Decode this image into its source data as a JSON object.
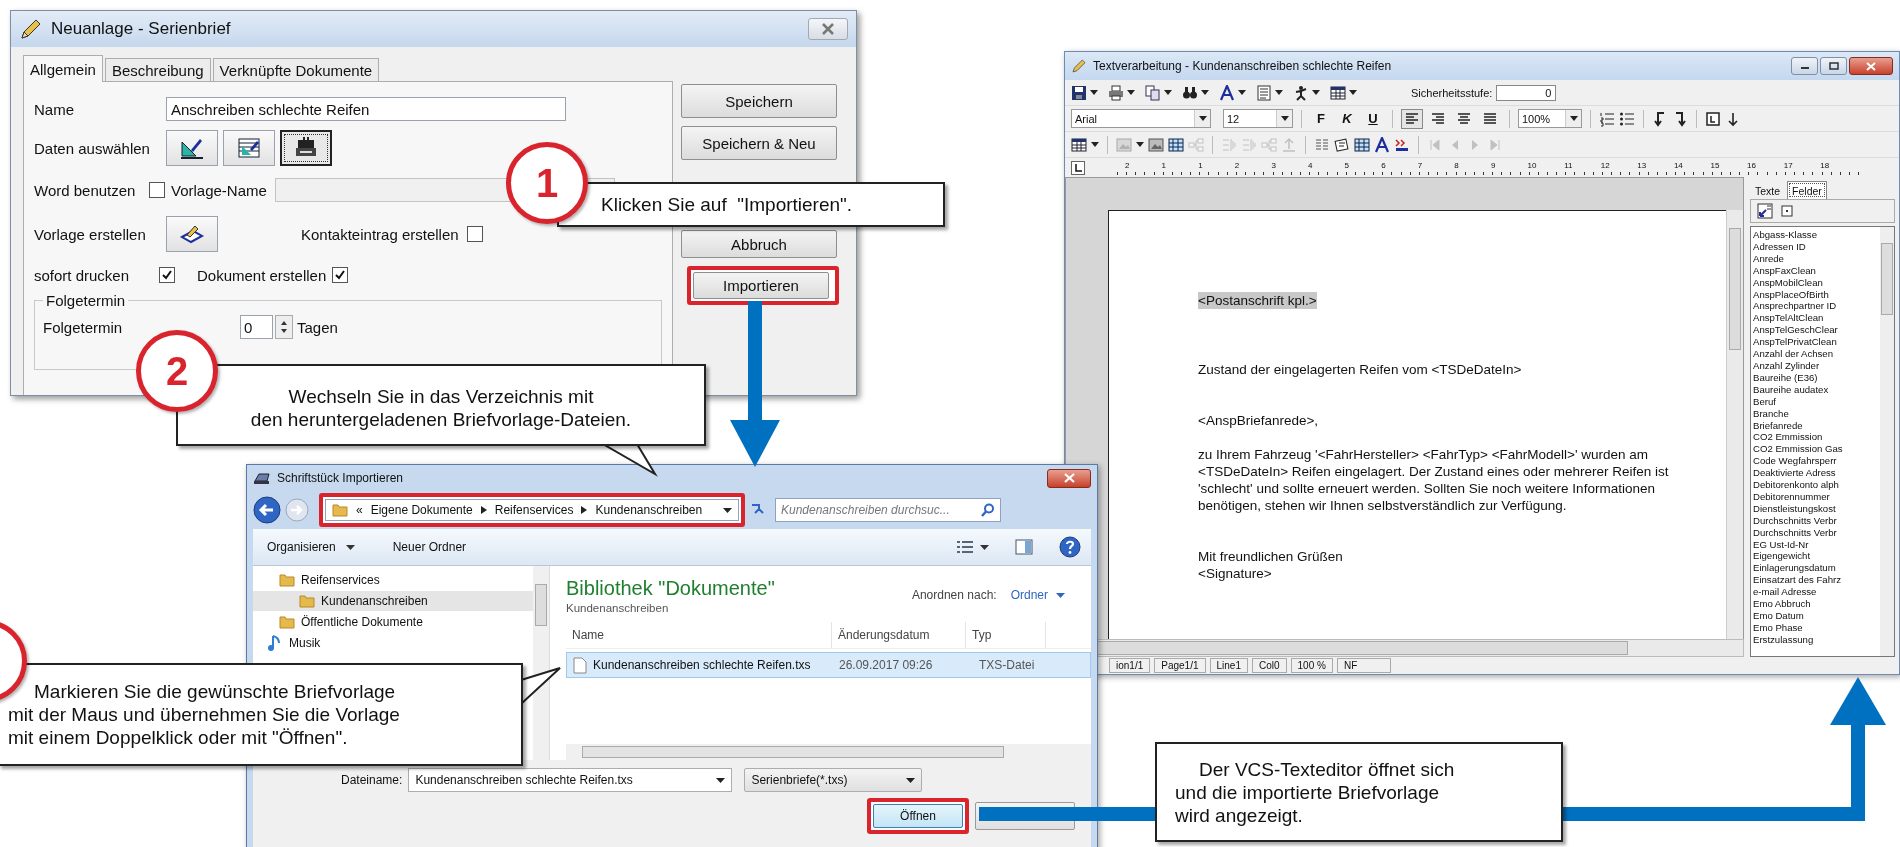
{
  "setup_dialog": {
    "title": "Neuanlage - Serienbrief",
    "tabs": [
      {
        "label": "Allgemein",
        "selected": true
      },
      {
        "label": "Beschreibung",
        "selected": false
      },
      {
        "label": "Verknüpfte Dokumente",
        "selected": false
      }
    ],
    "name": {
      "label": "Name",
      "value": "Anschreiben schlechte Reifen"
    },
    "data_select": {
      "label": "Daten auswählen",
      "options": [
        {
          "selected": false
        },
        {
          "selected": false
        },
        {
          "selected": true
        }
      ]
    },
    "use_word": {
      "label": "Word benutzen",
      "checked": false
    },
    "template_name": {
      "label": "Vorlage-Name",
      "disabled": true
    },
    "create_template": {
      "label": "Vorlage erstellen"
    },
    "contact_entry": {
      "label": "Kontakteintrag erstellen",
      "checked": false
    },
    "print_now": {
      "label": "sofort drucken",
      "checked": true
    },
    "create_document": {
      "label": "Dokument erstellen",
      "checked": true
    },
    "followup": {
      "group": "Folgetermin",
      "label": "Folgetermin",
      "value": "0",
      "unit": "Tagen"
    },
    "buttons": [
      {
        "label": "Speichern",
        "highlighted": false
      },
      {
        "label": "Speichern & Neu",
        "highlighted": false
      },
      {
        "label": "Abbruch",
        "highlighted": false
      },
      {
        "label": "Importieren",
        "highlighted": true
      }
    ]
  },
  "editor": {
    "title": "Textverarbeitung - Kundenanschreiben schlechte Reifen",
    "security_label": "Sicherheitsstufe:",
    "security_value": "0",
    "font": "Arial",
    "size": "12",
    "format_buttons": [
      "F",
      "K",
      "U"
    ],
    "alignment": [
      {
        "selected": true
      },
      {
        "selected": false
      },
      {
        "selected": false
      },
      {
        "selected": false
      }
    ],
    "zoom": "100%",
    "ruler_labels": [
      "2",
      "1",
      "1",
      "2",
      "3",
      "4",
      "5",
      "6",
      "7",
      "8",
      "9",
      "10",
      "11",
      "12",
      "13",
      "14",
      "15",
      "16",
      "17",
      "18"
    ],
    "paragraphs": [
      {
        "kind": "address",
        "text": "<Postanschrift kpl.>",
        "selected": true
      },
      {
        "kind": "subject",
        "text": "Zustand der eingelagerten Reifen vom <TSDeDateIn>",
        "selected": false
      },
      {
        "kind": "salutation",
        "text": "<AnspBriefanrede>,",
        "selected": false
      },
      {
        "kind": "body",
        "text": "zu Ihrem Fahrzeug '<FahrHersteller> <FahrTyp> <FahrModell>' wurden am <TSDeDateIn> Reifen eingelagert. Der Zustand eines oder mehrerer Reifen ist 'schlecht' und sollte erneuert werden. Sollten Sie noch weitere Informationen benötigen, stehen wir Ihnen selbstverständlich zur Verfügung.",
        "selected": false
      },
      {
        "kind": "closing",
        "text": "Mit freundlichen Grüßen",
        "selected": false
      },
      {
        "kind": "signature",
        "text": "<Signature>",
        "selected": false
      }
    ],
    "panel_tabs": [
      {
        "label": "Texte",
        "selected": false
      },
      {
        "label": "Felder",
        "selected": true
      }
    ],
    "fields": [
      "Abgass-Klasse",
      "Adressen ID",
      "Anrede",
      "AnspFaxClean",
      "AnspMobilClean",
      "AnspPlaceOfBirth",
      "Ansprechpartner ID",
      "AnspTelAltClean",
      "AnspTelGeschClear",
      "AnspTelPrivatClean",
      "Anzahl der Achsen",
      "Anzahl Zylinder",
      "Baureihe (E36)",
      "Baureihe audatex",
      "Beruf",
      "Branche",
      "Briefanrede",
      "CO2 Emmission",
      "CO2 Emmission Gas",
      "Code Wegfahrsperr",
      "Deaktivierte Adress",
      "Debitorenkonto alph",
      "Debitorennummer",
      "Dienstleistungskost",
      "Durchschnitts Verbr",
      "Durchschnitts Verbr",
      "EG Ust-Id-Nr",
      "Eigengewicht",
      "Einlagerungsdatum",
      "Einsatzart des Fahrz",
      "e-mail Adresse",
      "Emo Abbruch",
      "Emo Datum",
      "Emo Phase",
      "Erstzulassung"
    ],
    "status_bar": [
      "ion1/1",
      "Page1/1",
      "Line1",
      "Col0",
      "100 %",
      "NF"
    ]
  },
  "import_dialog": {
    "title": "Schriftstück Importieren",
    "path_prefix": "«",
    "path": [
      "Eigene Dokumente",
      "Reifenservices",
      "Kundenanschreiben"
    ],
    "search_placeholder": "Kundenanschreiben durchsuc...",
    "toolbar": [
      "Organisieren",
      "Neuer Ordner"
    ],
    "nav": [
      {
        "label": "Reifenservices",
        "kind": "folder",
        "selected": false,
        "children": [
          {
            "label": "Kundenanschreiben",
            "kind": "folder",
            "selected": true
          }
        ]
      },
      {
        "label": "Öffentliche Dokumente",
        "kind": "folder",
        "selected": false
      },
      {
        "label": "Musik",
        "kind": "music",
        "selected": false
      }
    ],
    "library_title": "Bibliothek \"Dokumente\"",
    "library_subtitle": "Kundenanschreiben",
    "arrange_label": "Anordnen nach:",
    "arrange_value": "Ordner",
    "columns": [
      "Name",
      "Änderungsdatum",
      "Typ"
    ],
    "files": [
      {
        "name": "Kundenanschreiben schlechte Reifen.txs",
        "date": "26.09.2017 09:26",
        "type": "TXS-Datei",
        "selected": true
      }
    ],
    "filename_label": "Dateiname:",
    "filename": "Kundenanschreiben schlechte Reifen.txs",
    "filter": "Serienbriefe(*.txs)",
    "open_button": "Öffnen"
  },
  "callouts": [
    {
      "marker": true,
      "number": "1",
      "lines": [
        "Klicken Sie auf  \"Importieren\"."
      ]
    },
    {
      "marker": true,
      "number": "2",
      "lines": [
        "Wechseln Sie in das Verzeichnis mit",
        "den heruntergeladenen Briefvorlage-Dateien."
      ]
    },
    {
      "marker": true,
      "lines": [
        "Markieren Sie die gewünschte Briefvorlage",
        "mit der Maus und übernehmen Sie die Vorlage",
        "mit einem Doppelklick oder mit \"Öffnen\"."
      ]
    },
    {
      "marker": false,
      "lines": [
        "Der VCS-Texteditor öffnet sich",
        "und die importierte Briefvorlage",
        "wird angezeigt."
      ]
    }
  ]
}
